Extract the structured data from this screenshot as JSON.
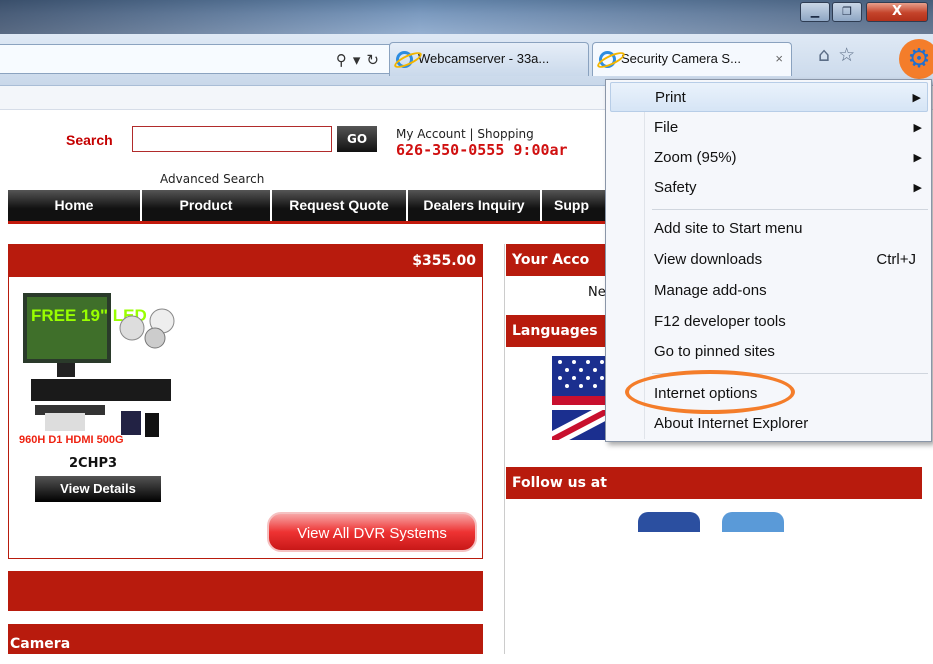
{
  "window": {
    "minimize_glyph": "▁",
    "maximize_glyph": "❐",
    "close_glyph": "X"
  },
  "tabs": [
    {
      "label": "Webcamserver - 33a...",
      "icon": "ie-icon"
    },
    {
      "label": "Security Camera S...",
      "icon": "ie-icon",
      "close": "×"
    }
  ],
  "address_bar": {
    "search_glyph": "⚲",
    "dropdown_glyph": "▾",
    "refresh_glyph": "↻"
  },
  "toolbar": {
    "home_glyph": "⌂",
    "favorites_glyph": "☆",
    "tools_glyph": "⚙"
  },
  "site": {
    "search_label": "Search",
    "search_value": "",
    "go_label": "GO",
    "account_links": "My Account   |   Shopping",
    "phone": "626-350-0555 9:00ar",
    "advanced_search": "Advanced Search",
    "nav": [
      "Home",
      "Product",
      "Request Quote",
      "Dealers Inquiry",
      "Supp"
    ],
    "price": "$355.00",
    "product_name": "2CHP3",
    "view_details": "View Details",
    "view_all": "View All DVR Systems",
    "camera_heading": "Camera",
    "account_heading": "Your Acco",
    "account_text": "Ne",
    "languages_heading": "Languages",
    "follow_heading": "Follow us at",
    "product_badge_text": "FREE 19\" LED",
    "product_caption": "960H D1 HDMI 500G"
  },
  "menu": {
    "items": [
      {
        "label": "Print",
        "submenu": true,
        "highlighted": true
      },
      {
        "label": "File",
        "submenu": true
      },
      {
        "label": "Zoom (95%)",
        "submenu": true
      },
      {
        "label": "Safety",
        "submenu": true
      },
      {
        "label": "Add site to Start menu"
      },
      {
        "label": "View downloads",
        "shortcut": "Ctrl+J"
      },
      {
        "label": "Manage add-ons"
      },
      {
        "label": "F12 developer tools"
      },
      {
        "label": "Go to pinned sites"
      },
      {
        "label": "Internet options",
        "annotated": true
      },
      {
        "label": "About Internet Explorer"
      }
    ],
    "arrow_glyph": "▶"
  },
  "colors": {
    "site_red": "#b81b0d",
    "annotation_orange": "#f47d2a",
    "ie_blue": "#1e6fcf"
  }
}
